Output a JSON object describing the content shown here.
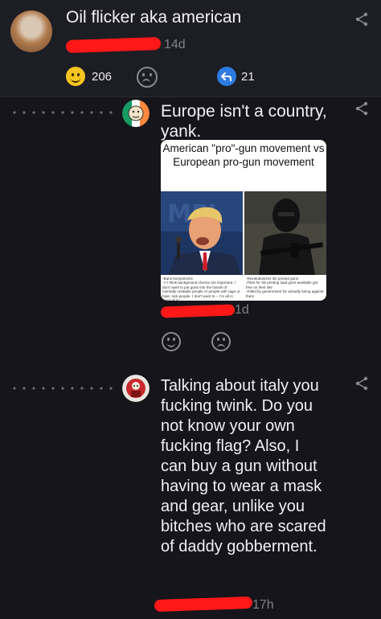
{
  "post": {
    "title": "Oil flicker aka american",
    "time": "14d",
    "upvotes": "206",
    "replies": "21"
  },
  "comments": [
    {
      "text": "Europe isn't a country, yank.",
      "time": "1d",
      "card": {
        "caption": "American \"pro\"-gun movement vs European pro-gun movement",
        "left_note": "-Bans bumpstocks\n->\"I think background checks are important. I don't want to put guns into the hands of mentally unstable people or people with rage or hate, sick people. I don't want to -- I'm all in favor of it.\"\n-Mentally obvious controlled opposition",
        "right_note": "-Revolutionizes 3D printed guns\n-Files for 3D printing said guns available got free on their site\n-Killed by government for actually being against them"
      }
    },
    {
      "text": "Talking about italy you fucking twink. Do you not know your own fucking flag? Also, I can buy a gun without having to wear a mask and gear, unlike you bitches who are scared of daddy gobberment.",
      "time": "17h"
    }
  ],
  "colors": {
    "background": "#15151b",
    "post_background": "#1d1d24",
    "redaction": "#ff1818",
    "accent_blue": "#2d7be0",
    "emoji_yellow": "#f7c520"
  }
}
